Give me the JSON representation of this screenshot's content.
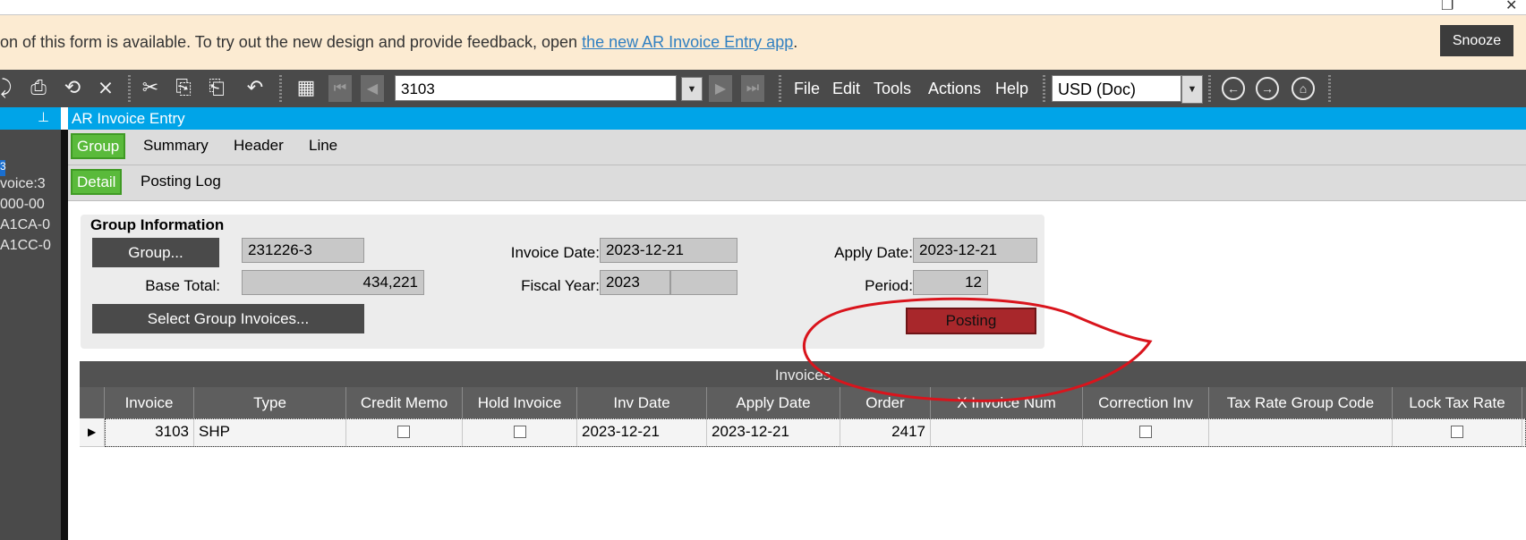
{
  "banner": {
    "text": "on of this form is available. To try out the new design and provide feedback, open ",
    "link": "the new AR Invoice Entry app",
    "tail": ".",
    "snooze": "Snooze"
  },
  "toolbar": {
    "record": "3103",
    "menus": [
      "File",
      "Edit",
      "Tools",
      "Actions",
      "Help"
    ],
    "currency": "USD (Doc)"
  },
  "sidebar": {
    "lines": [
      "3",
      "voice:3",
      "000-00",
      "A1CA-0",
      "A1CC-0"
    ]
  },
  "form": {
    "title": "AR Invoice Entry",
    "tabs_top": [
      "Group",
      "Summary",
      "Header",
      "Line"
    ],
    "tabs_bottom": [
      "Detail",
      "Posting Log"
    ]
  },
  "group_info": {
    "title": "Group Information",
    "group_btn": "Group...",
    "group_value": "231226-3",
    "base_total_label": "Base Total:",
    "base_total_value": "434,221",
    "select_btn": "Select Group Invoices...",
    "invoice_date_label": "Invoice Date:",
    "invoice_date_value": "2023-12-21",
    "fiscal_year_label": "Fiscal Year:",
    "fiscal_year_value": "2023",
    "apply_date_label": "Apply Date:",
    "apply_date_value": "2023-12-21",
    "period_label": "Period:",
    "period_value": "12",
    "status": "Posting",
    "status_color": "#a8272b"
  },
  "invoices": {
    "title": "Invoices",
    "columns": [
      "Invoice",
      "Type",
      "Credit Memo",
      "Hold Invoice",
      "Inv Date",
      "Apply Date",
      "Order",
      "X Invoice Num",
      "Correction Inv",
      "Tax Rate Group Code",
      "Lock Tax Rate"
    ],
    "rows": [
      {
        "invoice": "3103",
        "type": "SHP",
        "credit_memo": false,
        "hold_invoice": false,
        "inv_date": "2023-12-21",
        "apply_date": "2023-12-21",
        "order": "2417",
        "x_invoice_num": "",
        "correction_inv": false,
        "tax_rate_group_code": "",
        "lock_tax_rate": false
      }
    ]
  },
  "colors": {
    "accent_blue": "#00a4e8",
    "tab_green": "#5aba3b",
    "banner_bg": "#fcebd2",
    "annotation_red": "#d9141c"
  }
}
